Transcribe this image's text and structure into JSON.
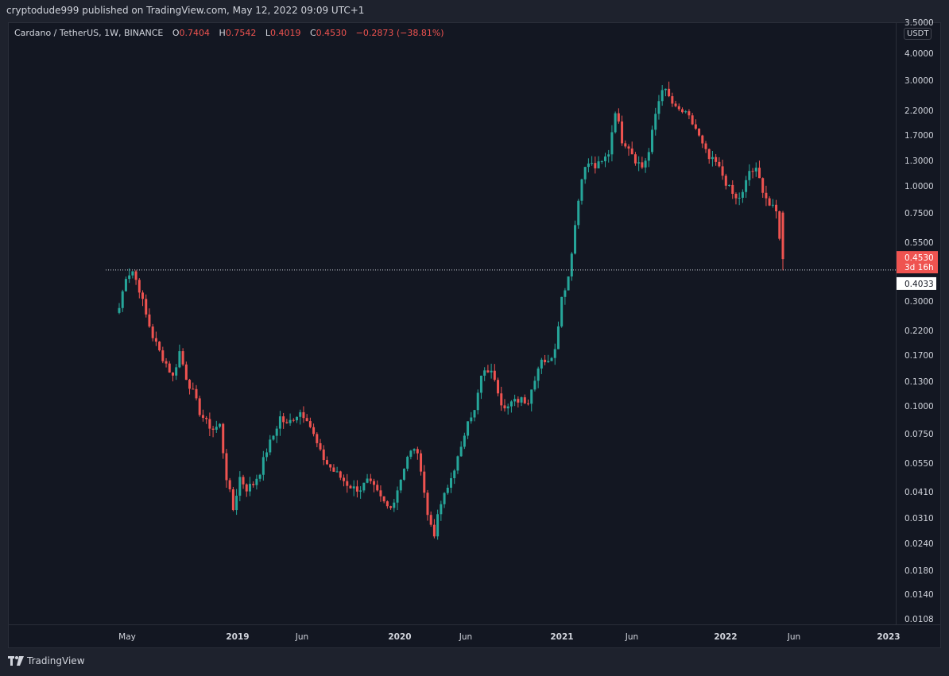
{
  "header": {
    "publish_text": "cryptodude999 published on TradingView.com, May 12, 2022 09:09 UTC+1"
  },
  "legend": {
    "symbol": "Cardano / TetherUS, 1W, BINANCE",
    "open_label": "O",
    "open_value": "0.7404",
    "high_label": "H",
    "high_value": "0.7542",
    "low_label": "L",
    "low_value": "0.4019",
    "close_label": "C",
    "close_value": "0.4530",
    "change": "−0.2873 (−38.81%)"
  },
  "price_axis": {
    "currency": "USDT",
    "current_price": "0.4530",
    "countdown": "3d 16h",
    "line_price": "0.4033"
  },
  "footer": {
    "brand": "TradingView"
  },
  "colors": {
    "up": "#26a69a",
    "down": "#ef5350",
    "background": "#131722",
    "text": "#d1d4dc"
  },
  "chart_data": {
    "type": "candlestick",
    "scale": "log",
    "ylim": [
      0.0095,
      5.5
    ],
    "y_ticks": [
      "3.5000",
      "4.0000",
      "3.0000",
      "2.2000",
      "1.7000",
      "1.3000",
      "1.0000",
      "0.7500",
      "0.5500",
      "0.3000",
      "0.2200",
      "0.1700",
      "0.1300",
      "0.1000",
      "0.0750",
      "0.0550",
      "0.0410",
      "0.0310",
      "0.0240",
      "0.0180",
      "0.0140",
      "0.0108"
    ],
    "x_ticks": [
      "May",
      "2019",
      "Jun",
      "2020",
      "Jun",
      "2021",
      "Jun",
      "2022",
      "Jun",
      "2023"
    ],
    "horizontal_line": 0.4033,
    "close_path": [
      [
        "2018-04",
        0.27
      ],
      [
        "2018-04",
        0.38
      ],
      [
        "2018-05",
        0.4
      ],
      [
        "2018-05",
        0.33
      ],
      [
        "2018-06",
        0.25
      ],
      [
        "2018-06",
        0.2
      ],
      [
        "2018-07",
        0.17
      ],
      [
        "2018-07",
        0.15
      ],
      [
        "2018-08",
        0.13
      ],
      [
        "2018-08",
        0.17
      ],
      [
        "2018-09",
        0.13
      ],
      [
        "2018-09",
        0.11
      ],
      [
        "2018-10",
        0.09
      ],
      [
        "2018-10",
        0.08
      ],
      [
        "2018-11",
        0.075
      ],
      [
        "2018-11",
        0.078
      ],
      [
        "2018-12",
        0.045
      ],
      [
        "2018-12",
        0.032
      ],
      [
        "2019-01",
        0.045
      ],
      [
        "2019-01",
        0.04
      ],
      [
        "2019-02",
        0.042
      ],
      [
        "2019-02",
        0.048
      ],
      [
        "2019-03",
        0.06
      ],
      [
        "2019-03",
        0.07
      ],
      [
        "2019-04",
        0.085
      ],
      [
        "2019-04",
        0.078
      ],
      [
        "2019-05",
        0.085
      ],
      [
        "2019-05",
        0.09
      ],
      [
        "2019-06",
        0.085
      ],
      [
        "2019-06",
        0.07
      ],
      [
        "2019-07",
        0.058
      ],
      [
        "2019-07",
        0.052
      ],
      [
        "2019-08",
        0.048
      ],
      [
        "2019-08",
        0.045
      ],
      [
        "2019-09",
        0.042
      ],
      [
        "2019-09",
        0.04
      ],
      [
        "2019-10",
        0.04
      ],
      [
        "2019-10",
        0.043
      ],
      [
        "2019-11",
        0.04
      ],
      [
        "2019-11",
        0.036
      ],
      [
        "2019-12",
        0.033
      ],
      [
        "2019-12",
        0.035
      ],
      [
        "2020-01",
        0.045
      ],
      [
        "2020-01",
        0.055
      ],
      [
        "2020-02",
        0.062
      ],
      [
        "2020-02",
        0.05
      ],
      [
        "2020-03",
        0.03
      ],
      [
        "2020-03",
        0.025
      ],
      [
        "2020-04",
        0.034
      ],
      [
        "2020-04",
        0.04
      ],
      [
        "2020-05",
        0.05
      ],
      [
        "2020-05",
        0.06
      ],
      [
        "2020-06",
        0.085
      ],
      [
        "2020-06",
        0.09
      ],
      [
        "2020-07",
        0.13
      ],
      [
        "2020-07",
        0.14
      ],
      [
        "2020-08",
        0.13
      ],
      [
        "2020-08",
        0.1
      ],
      [
        "2020-09",
        0.095
      ],
      [
        "2020-09",
        0.1
      ],
      [
        "2020-10",
        0.105
      ],
      [
        "2020-10",
        0.1
      ],
      [
        "2020-11",
        0.13
      ],
      [
        "2020-11",
        0.16
      ],
      [
        "2020-12",
        0.15
      ],
      [
        "2020-12",
        0.18
      ],
      [
        "2021-01",
        0.3
      ],
      [
        "2021-01",
        0.38
      ],
      [
        "2021-02",
        0.65
      ],
      [
        "2021-02",
        1.1
      ],
      [
        "2021-03",
        1.25
      ],
      [
        "2021-03",
        1.2
      ],
      [
        "2021-04",
        1.25
      ],
      [
        "2021-04",
        1.4
      ],
      [
        "2021-05",
        2.2
      ],
      [
        "2021-05",
        1.6
      ],
      [
        "2021-06",
        1.5
      ],
      [
        "2021-06",
        1.3
      ],
      [
        "2021-07",
        1.2
      ],
      [
        "2021-07",
        1.4
      ],
      [
        "2021-08",
        2.1
      ],
      [
        "2021-08",
        2.8
      ],
      [
        "2021-09",
        2.5
      ],
      [
        "2021-09",
        2.2
      ],
      [
        "2021-10",
        2.15
      ],
      [
        "2021-10",
        2.0
      ],
      [
        "2021-11",
        1.8
      ],
      [
        "2021-11",
        1.5
      ],
      [
        "2021-12",
        1.3
      ],
      [
        "2021-12",
        1.25
      ],
      [
        "2022-01",
        1.1
      ],
      [
        "2022-01",
        0.95
      ],
      [
        "2022-02",
        0.85
      ],
      [
        "2022-02",
        0.9
      ],
      [
        "2022-03",
        1.15
      ],
      [
        "2022-03",
        1.15
      ],
      [
        "2022-04",
        0.95
      ],
      [
        "2022-04",
        0.8
      ],
      [
        "2022-05",
        0.74
      ],
      [
        "2022-05",
        0.453
      ]
    ]
  }
}
